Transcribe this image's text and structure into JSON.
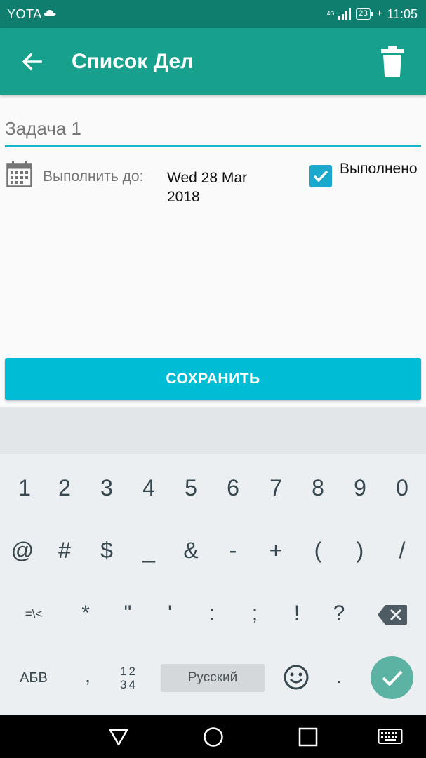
{
  "status_bar": {
    "carrier": "YOTA",
    "network": "4G",
    "battery": "23",
    "time": "11:05"
  },
  "toolbar": {
    "title": "Список Дел",
    "back_icon": "arrow-left-icon",
    "delete_icon": "trash-icon"
  },
  "form": {
    "task_value": "Задача 1",
    "due_label": "Выполнить до:",
    "due_date": "Wed 28 Mar 2018",
    "done_label": "Выполнено",
    "done_checked": true,
    "save_label": "СОХРАНИТЬ"
  },
  "keyboard": {
    "row1": [
      "1",
      "2",
      "3",
      "4",
      "5",
      "6",
      "7",
      "8",
      "9",
      "0"
    ],
    "row2": [
      "@",
      "#",
      "$",
      "_",
      "&",
      "-",
      "+",
      "(",
      ")",
      "/"
    ],
    "row3": [
      "=\\<",
      "*",
      "\"",
      "'",
      ":",
      ";",
      "!",
      "?"
    ],
    "layout_switch": "АБВ",
    "comma": ",",
    "numpad_top": "12",
    "numpad_bottom": "34",
    "space_label": "Русский",
    "period": "."
  },
  "colors": {
    "status_bar": "#0f7e6f",
    "toolbar": "#17a08b",
    "accent": "#00bcd4",
    "checkbox": "#1aa9cc",
    "enter_key": "#5cb3a4"
  }
}
